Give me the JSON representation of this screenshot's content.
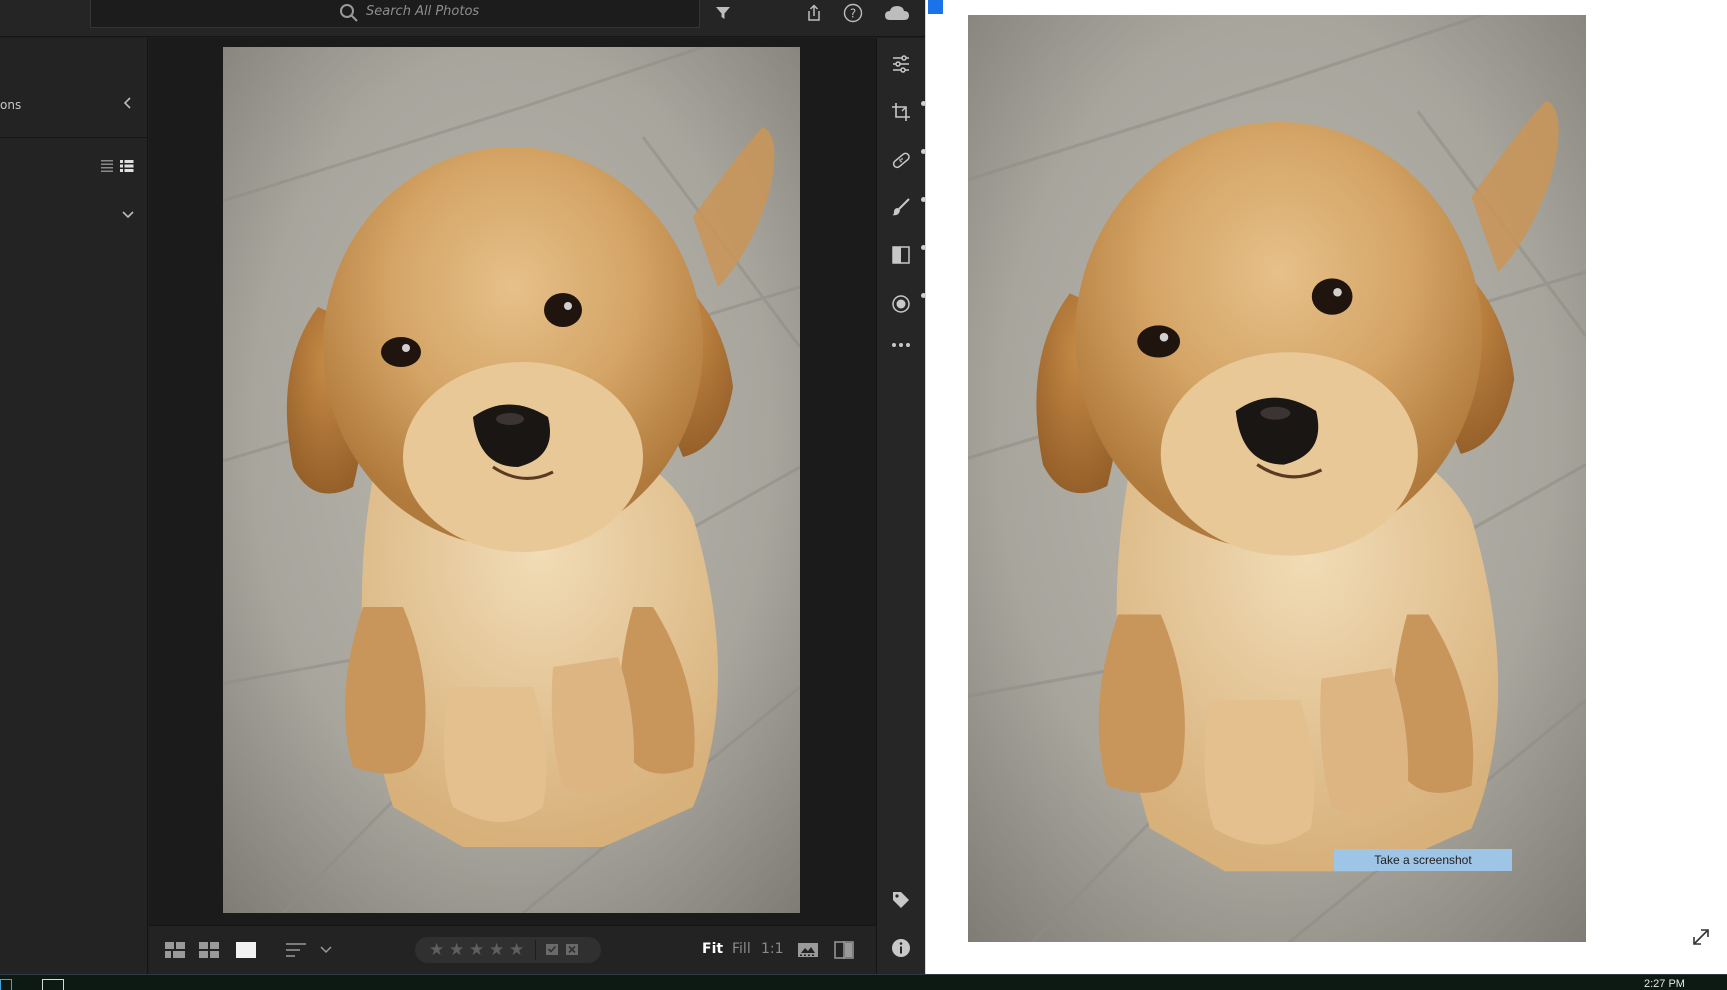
{
  "lightroom": {
    "search_placeholder": "Search All Photos",
    "left_panel_header": "ons",
    "zoom": {
      "fit": "Fit",
      "fill": "Fill",
      "one_to_one": "1:1"
    },
    "rating_stars": 5
  },
  "preview": {
    "screenshot_button": "Take a screenshot"
  },
  "taskbar": {
    "time": "2:27 PM"
  },
  "colors": {
    "lr_bg": "#1f1f1f",
    "panel_bg": "#232323",
    "accent_blue": "#1a73e8",
    "screenshot_button_bg": "#9ec4e6"
  }
}
